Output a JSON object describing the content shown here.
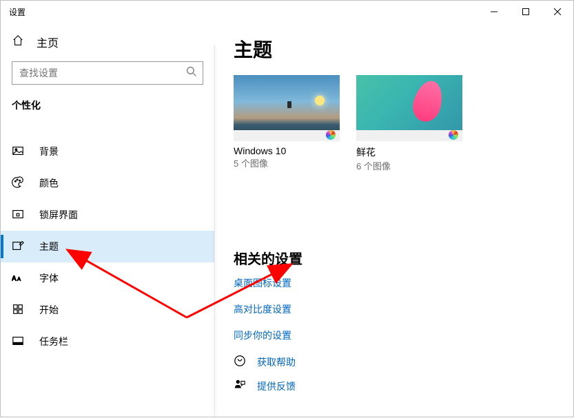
{
  "titlebar": {
    "title": "设置"
  },
  "sidebar": {
    "home": "主页",
    "searchPlaceholder": "查找设置",
    "category": "个性化",
    "items": [
      {
        "label": "背景",
        "icon": "image-icon"
      },
      {
        "label": "颜色",
        "icon": "palette-icon"
      },
      {
        "label": "锁屏界面",
        "icon": "lock-screen-icon"
      },
      {
        "label": "主题",
        "icon": "pen-icon"
      },
      {
        "label": "字体",
        "icon": "font-icon"
      },
      {
        "label": "开始",
        "icon": "grid-icon"
      },
      {
        "label": "任务栏",
        "icon": "taskbar-icon"
      }
    ]
  },
  "content": {
    "title": "主题",
    "themes": [
      {
        "name": "Windows 10",
        "sub": "5 个图像"
      },
      {
        "name": "鲜花",
        "sub": "6 个图像"
      }
    ],
    "relatedTitle": "相关的设置",
    "links": [
      "桌面图标设置",
      "高对比度设置",
      "同步你的设置"
    ],
    "helpLabel": "获取帮助",
    "feedbackLabel": "提供反馈"
  }
}
